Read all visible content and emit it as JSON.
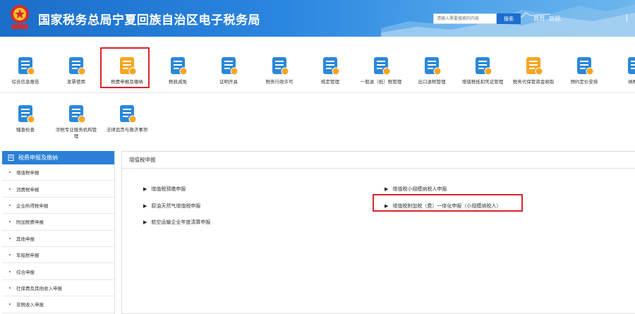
{
  "header": {
    "title": "国家税务总局宁夏回族自治区电子税务局",
    "search_placeholder": "请输入需要搜索的内容",
    "search_label": "搜索",
    "nav_home": "首页",
    "nav_welcome": "欢迎,"
  },
  "icons": [
    {
      "label": "综合信息报告",
      "icon": "clipboard-icon",
      "color": "#2b88d8"
    },
    {
      "label": "发票使用",
      "icon": "invoice-icon",
      "color": "#2b88d8"
    },
    {
      "label": "税费申报及缴纳",
      "icon": "tax-payment-icon",
      "color": "#f5a623"
    },
    {
      "label": "税收减免",
      "icon": "tax-relief-icon",
      "color": "#2b88d8"
    },
    {
      "label": "证明开具",
      "icon": "certificate-icon",
      "color": "#2b88d8"
    },
    {
      "label": "税务行政许可",
      "icon": "permit-icon",
      "color": "#2b88d8"
    },
    {
      "label": "核定管理",
      "icon": "assessment-icon",
      "color": "#2b88d8"
    },
    {
      "label": "一般退（抵）税管理",
      "icon": "refund-icon",
      "color": "#2b88d8"
    },
    {
      "label": "出口退税管理",
      "icon": "export-refund-icon",
      "color": "#2b88d8"
    },
    {
      "label": "增值税抵扣凭证管理",
      "icon": "vat-voucher-icon",
      "color": "#2b88d8"
    },
    {
      "label": "税务代保管资金收取",
      "icon": "custody-fund-icon",
      "color": "#f5a623"
    },
    {
      "label": "预约定价安排",
      "icon": "pricing-arrangement-icon",
      "color": "#2b88d8"
    },
    {
      "label": "纳税信",
      "icon": "credit-icon",
      "color": "#2b88d8"
    },
    {
      "label": "稽查检查",
      "icon": "inspection-icon",
      "color": "#2b88d8"
    },
    {
      "label": "涉税专业服务机构管理",
      "icon": "agency-icon",
      "color": "#2b88d8"
    },
    {
      "label": "法律追责与救济事项",
      "icon": "legal-icon",
      "color": "#2b88d8"
    }
  ],
  "sidebar": {
    "title": "税费申报及缴纳",
    "items": [
      "增值税申报",
      "消费税申报",
      "企业所得税申报",
      "附加税费申报",
      "其他申报",
      "车船税申报",
      "综合申报",
      "社保费及其他收入申报",
      "非税收入申报"
    ]
  },
  "panel": {
    "title": "增值税申报",
    "links": [
      "增值税预缴申报",
      "原油天然气增值税申报",
      "航空运输企业年度清算申报",
      "增值税小规模纳税人申报",
      "增值税附加税（费）一体化申报（小规模纳税人）"
    ]
  },
  "colors": {
    "header_blue": "#2b86e0",
    "accent_blue": "#2a80d8",
    "highlight_red": "#d9262b",
    "icon_orange": "#f5a623"
  }
}
